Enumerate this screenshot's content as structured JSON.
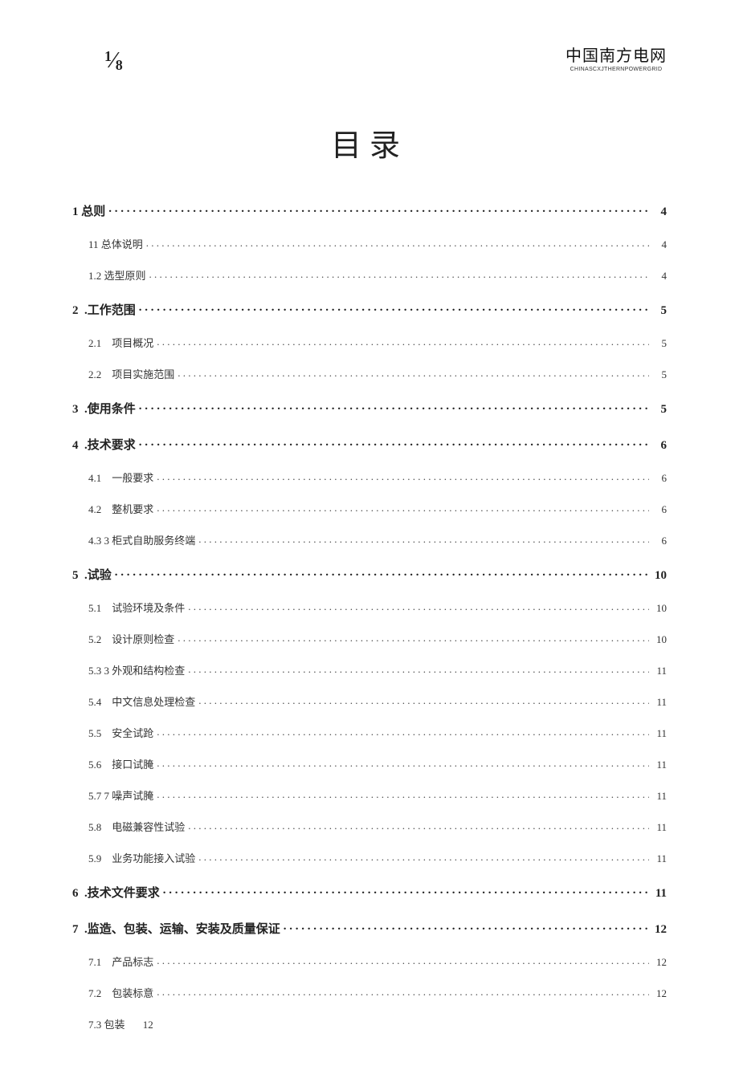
{
  "header": {
    "page_fraction_top": "1",
    "page_fraction_bottom": "8",
    "logo_cn": "中国南方电网",
    "logo_en": "CHINASCXJTHERNPOWERGRID"
  },
  "title": "目录",
  "toc": [
    {
      "level": 1,
      "num": "1",
      "title": " 总则",
      "page": "4"
    },
    {
      "level": 2,
      "num": "11",
      "title": " 总体说明",
      "page": "4"
    },
    {
      "level": 2,
      "num": "1.2",
      "title": " 选型原则",
      "page": "4"
    },
    {
      "level": 1,
      "num": "2",
      "title": "  .工作范围",
      "page": "5"
    },
    {
      "level": 2,
      "num": "2.1",
      "title": "    项目概况",
      "page": "5"
    },
    {
      "level": 2,
      "num": "2.2",
      "title": "    项目实施范围",
      "page": "5"
    },
    {
      "level": 1,
      "num": "3",
      "title": "  .使用条件",
      "page": "5"
    },
    {
      "level": 1,
      "num": "4",
      "title": "  .技术要求",
      "page": "6"
    },
    {
      "level": 2,
      "num": "4.1",
      "title": "    一般要求",
      "page": "6"
    },
    {
      "level": 2,
      "num": "4.2",
      "title": "    整机要求",
      "page": "6"
    },
    {
      "level": 2,
      "num": "4.3",
      "title": " 3 柜式自助服务终端",
      "page": "6"
    },
    {
      "level": 1,
      "num": "5",
      "title": "  .试验",
      "page": "10"
    },
    {
      "level": 2,
      "num": "5.1",
      "title": "    试验环境及条件",
      "page": "10"
    },
    {
      "level": 2,
      "num": "5.2",
      "title": "    设计原则检查",
      "page": "10"
    },
    {
      "level": 2,
      "num": "5.3",
      "title": " 3 外观和结构检查",
      "page": "11"
    },
    {
      "level": 2,
      "num": "5.4",
      "title": "    中文信息处理检查",
      "page": "11"
    },
    {
      "level": 2,
      "num": "5.5",
      "title": "    安全试跄",
      "page": "11"
    },
    {
      "level": 2,
      "num": "5.6",
      "title": "    接口试腌",
      "page": "11"
    },
    {
      "level": 2,
      "num": "5.7",
      "title": " 7 噪声试腌",
      "page": "11"
    },
    {
      "level": 2,
      "num": "5.8",
      "title": "    电磁兼容性试验",
      "page": "11"
    },
    {
      "level": 2,
      "num": "5.9",
      "title": "    业务功能接入试验",
      "page": "11"
    },
    {
      "level": 1,
      "num": "6",
      "title": "  .技术文件要求",
      "page": "11"
    },
    {
      "level": 1,
      "num": "7",
      "title": "  .监造、包装、运输、安装及质量保证",
      "page": "12"
    },
    {
      "level": 2,
      "num": "7.1",
      "title": "    产品标志",
      "page": "12"
    },
    {
      "level": 2,
      "num": "7.2",
      "title": "    包装标意",
      "page": "12"
    },
    {
      "level": 2,
      "num": "7.3",
      "title": " 包装 ",
      "page": "12",
      "noline": true
    }
  ]
}
